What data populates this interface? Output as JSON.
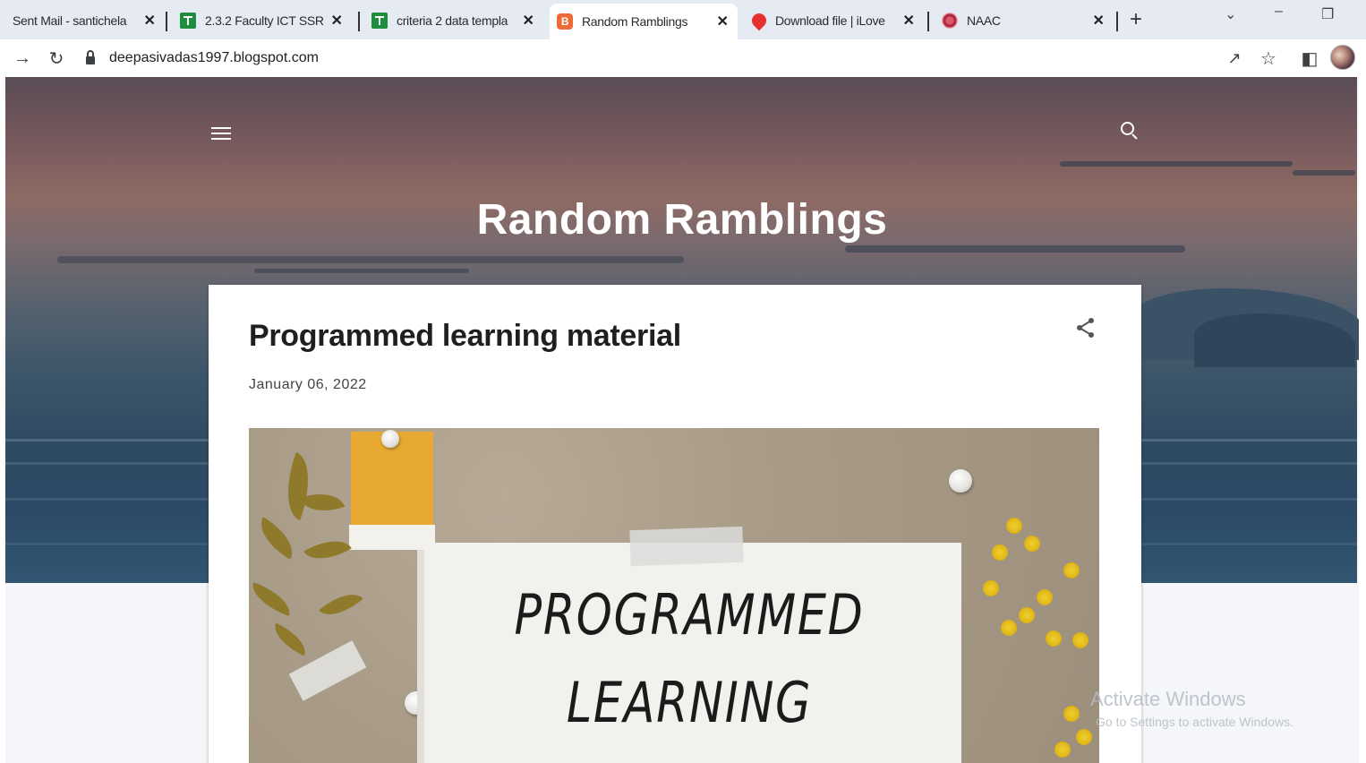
{
  "browser": {
    "tabs": [
      {
        "title": "Sent Mail - santichela",
        "favicon": "gmail-icon"
      },
      {
        "title": "2.3.2 Faculty ICT SSR",
        "favicon": "google-sheets-icon"
      },
      {
        "title": "criteria 2 data templa",
        "favicon": "google-sheets-icon"
      },
      {
        "title": "Random Ramblings",
        "favicon": "blogger-icon",
        "active": true
      },
      {
        "title": "Download file | iLove",
        "favicon": "ilovepdf-icon"
      },
      {
        "title": "NAAC",
        "favicon": "naac-icon"
      }
    ],
    "close_glyph": "✕",
    "new_tab_glyph": "+",
    "url": "deepasivadas1997.blogspot.com"
  },
  "blog": {
    "title": "Random Ramblings",
    "post": {
      "title": "Programmed learning material",
      "date": "January 06, 2022",
      "image_text_line1": "PROGRAMMED",
      "image_text_line2": "LEARNING"
    }
  },
  "overlay": {
    "activate_title": "Activate Windows",
    "activate_subtitle": "Go to Settings to activate Windows."
  },
  "colors": {
    "tab_strip": "#e6ebf3",
    "sheets_green": "#1e8e3e",
    "blogger_orange": "#f06a35",
    "note_yellow": "#e8a932"
  }
}
